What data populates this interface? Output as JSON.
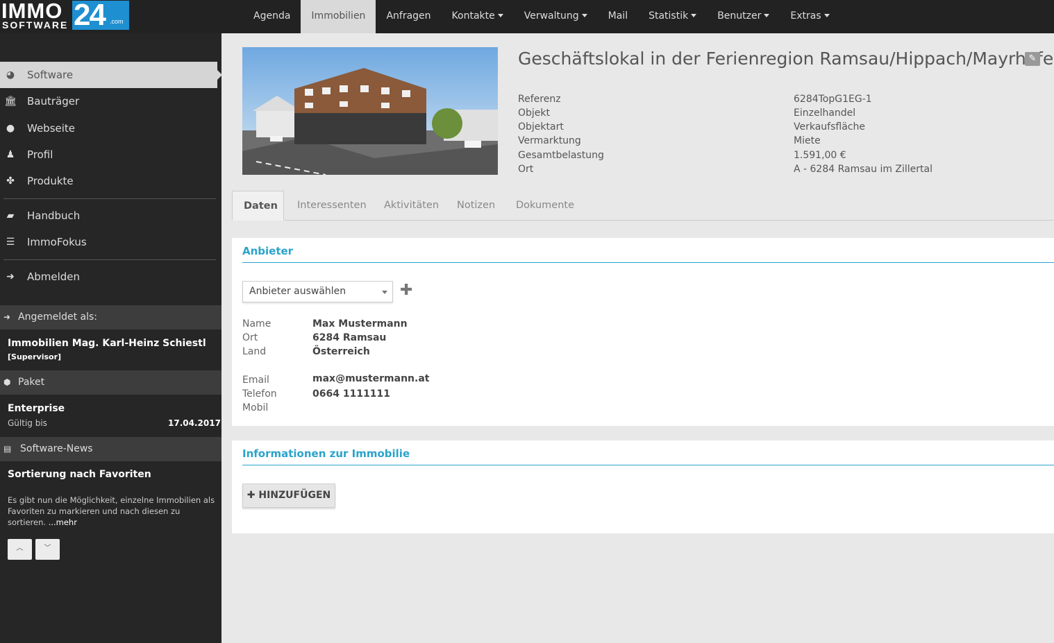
{
  "logo": {
    "line1": "IMMO",
    "line2": "SOFTWARE",
    "number": "24",
    "suffix": ".com"
  },
  "nav": [
    {
      "label": "Agenda",
      "dropdown": false,
      "active": false
    },
    {
      "label": "Immobilien",
      "dropdown": false,
      "active": true
    },
    {
      "label": "Anfragen",
      "dropdown": false,
      "active": false
    },
    {
      "label": "Kontakte",
      "dropdown": true,
      "active": false
    },
    {
      "label": "Verwaltung",
      "dropdown": true,
      "active": false
    },
    {
      "label": "Mail",
      "dropdown": false,
      "active": false
    },
    {
      "label": "Statistik",
      "dropdown": true,
      "active": false
    },
    {
      "label": "Benutzer",
      "dropdown": true,
      "active": false
    },
    {
      "label": "Extras",
      "dropdown": true,
      "active": false
    }
  ],
  "sidebar": {
    "items": [
      {
        "label": "Software",
        "icon": "dashboard-icon"
      },
      {
        "label": "Bauträger",
        "icon": "bank-icon"
      },
      {
        "label": "Webseite",
        "icon": "globe-icon"
      },
      {
        "label": "Profil",
        "icon": "user-icon"
      },
      {
        "label": "Produkte",
        "icon": "cubes-icon"
      },
      {
        "label": "Handbuch",
        "icon": "book-icon"
      },
      {
        "label": "ImmoFokus",
        "icon": "list-icon"
      },
      {
        "label": "Abmelden",
        "icon": "sign-out-icon"
      }
    ],
    "logged_in_header": "Angemeldet als:",
    "user_name": "Immobilien Mag. Karl-Heinz Schiestl",
    "user_role": "[Supervisor]",
    "package_header": "Paket",
    "package_name": "Enterprise",
    "valid_label": "Gültig bis",
    "valid_date": "17.04.2017",
    "news_header": "Software-News",
    "news_title": "Sortierung nach Favoriten",
    "news_text": "Es gibt nun die Möglichkeit, einzelne Immobilien als Favoriten zu markieren und nach diesen zu sortieren.",
    "news_more": "...mehr"
  },
  "property": {
    "title": "Geschäftslokal in der Ferienregion Ramsau/Hippach/Mayrhofen",
    "facts": [
      {
        "label": "Referenz",
        "value": "6284TopG1EG-1"
      },
      {
        "label": "Objekt",
        "value": "Einzelhandel"
      },
      {
        "label": "Objektart",
        "value": "Verkaufsfläche"
      },
      {
        "label": "Vermarktung",
        "value": "Miete"
      },
      {
        "label": "Gesamtbelastung",
        "value": "1.591,00 €"
      },
      {
        "label": "Ort",
        "value": "A - 6284 Ramsau im Zillertal"
      }
    ]
  },
  "tabs": [
    "Daten",
    "Interessenten",
    "Aktivitäten",
    "Notizen",
    "Dokumente"
  ],
  "anbieter": {
    "title": "Anbieter",
    "select_value": "Anbieter auswählen",
    "fields": [
      {
        "label": "Name",
        "value": "Max Mustermann"
      },
      {
        "label": "Ort",
        "value": "6284 Ramsau"
      },
      {
        "label": "Land",
        "value": "Österreich"
      },
      {
        "label": "Email",
        "value": "max@mustermann.at"
      },
      {
        "label": "Telefon",
        "value": "0664 1111111"
      },
      {
        "label": "Mobil",
        "value": ""
      }
    ]
  },
  "info": {
    "title": "Informationen zur Immobilie",
    "add_button": "HINZUFÜGEN"
  },
  "colors": {
    "topbar": "#222222",
    "sidebar": "#262626",
    "accent": "#2aa3cc",
    "logo_blue": "#1e8fd0"
  }
}
